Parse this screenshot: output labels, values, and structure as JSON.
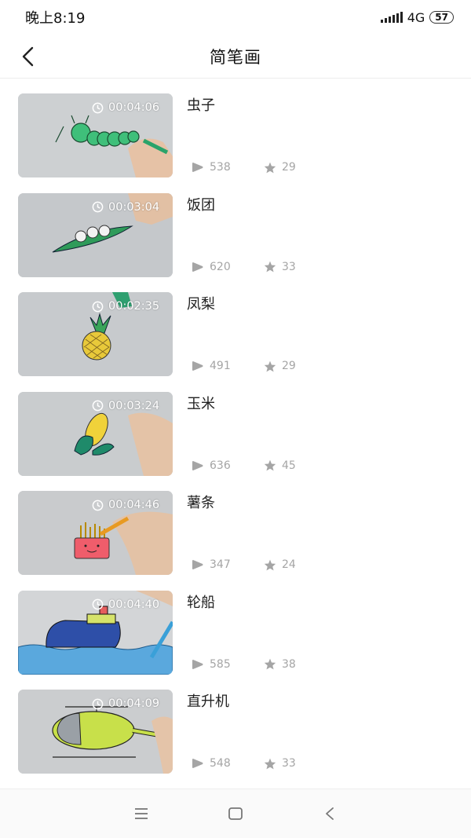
{
  "status_bar": {
    "time": "晚上8:19",
    "network": "4G",
    "battery": "57"
  },
  "header": {
    "title": "简笔画"
  },
  "videos": [
    {
      "title": "虫子",
      "duration": "00:04:06",
      "plays": "538",
      "favorites": "29"
    },
    {
      "title": "饭团",
      "duration": "00:03:04",
      "plays": "620",
      "favorites": "33"
    },
    {
      "title": "凤梨",
      "duration": "00:02:35",
      "plays": "491",
      "favorites": "29"
    },
    {
      "title": "玉米",
      "duration": "00:03:24",
      "plays": "636",
      "favorites": "45"
    },
    {
      "title": "薯条",
      "duration": "00:04:46",
      "plays": "347",
      "favorites": "24"
    },
    {
      "title": "轮船",
      "duration": "00:04:40",
      "plays": "585",
      "favorites": "38"
    },
    {
      "title": "直升机",
      "duration": "00:04:09",
      "plays": "548",
      "favorites": "33"
    }
  ],
  "icons": {
    "back": "chevron-left-icon",
    "duration": "clock-icon",
    "plays": "play-icon",
    "favorites": "star-icon",
    "menu": "menu-icon",
    "home": "home-square-icon",
    "system_back": "back-triangle-icon"
  },
  "colors": {
    "stat_gray": "#a5a5a5",
    "divider": "#ececec"
  }
}
